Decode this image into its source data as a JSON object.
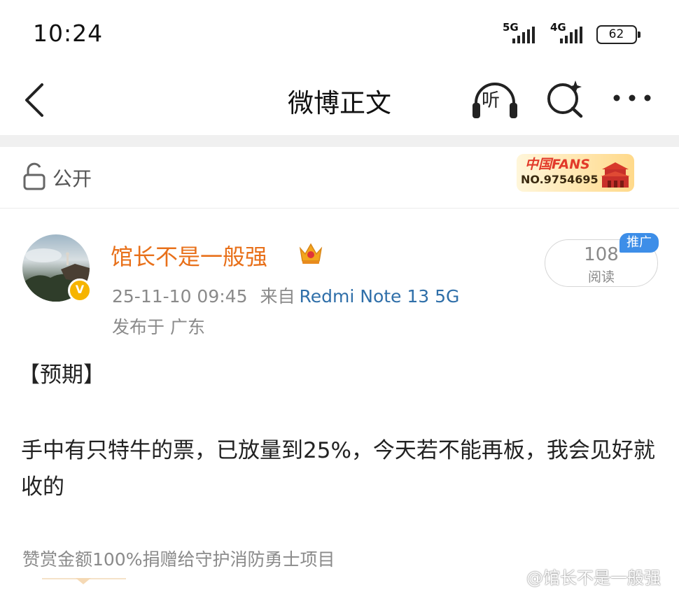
{
  "status_bar": {
    "time": "10:24",
    "signal1_label": "5G",
    "signal2_label": "4G",
    "battery_level": "62"
  },
  "nav": {
    "title": "微博正文",
    "listen_label": "听"
  },
  "visibility": {
    "label": "公开",
    "fans_badge_title": "中国FANS",
    "fans_badge_number": "NO.9754695"
  },
  "author": {
    "name": "馆长不是一般强",
    "verified_badge": "V",
    "timestamp": "25-11-10 09:45",
    "source_prefix": "来自",
    "source_device": "Redmi Note 13 5G",
    "location": "发布于 广东"
  },
  "reads": {
    "count": "108",
    "label": "阅读",
    "promo_label": "推广"
  },
  "post": {
    "tag": "【预期】",
    "body": "手中有只特牛的票，已放量到25%，今天若不能再板，我会见好就收的"
  },
  "donate_text": "赞赏金额100%捐赠给守护消防勇士项目",
  "watermark": "@馆长不是一般强",
  "colors": {
    "author_name": "#e8701a",
    "source_link": "#2f6fa9",
    "promo_badge": "#3d8ee8",
    "verified_badge": "#f6b400"
  }
}
